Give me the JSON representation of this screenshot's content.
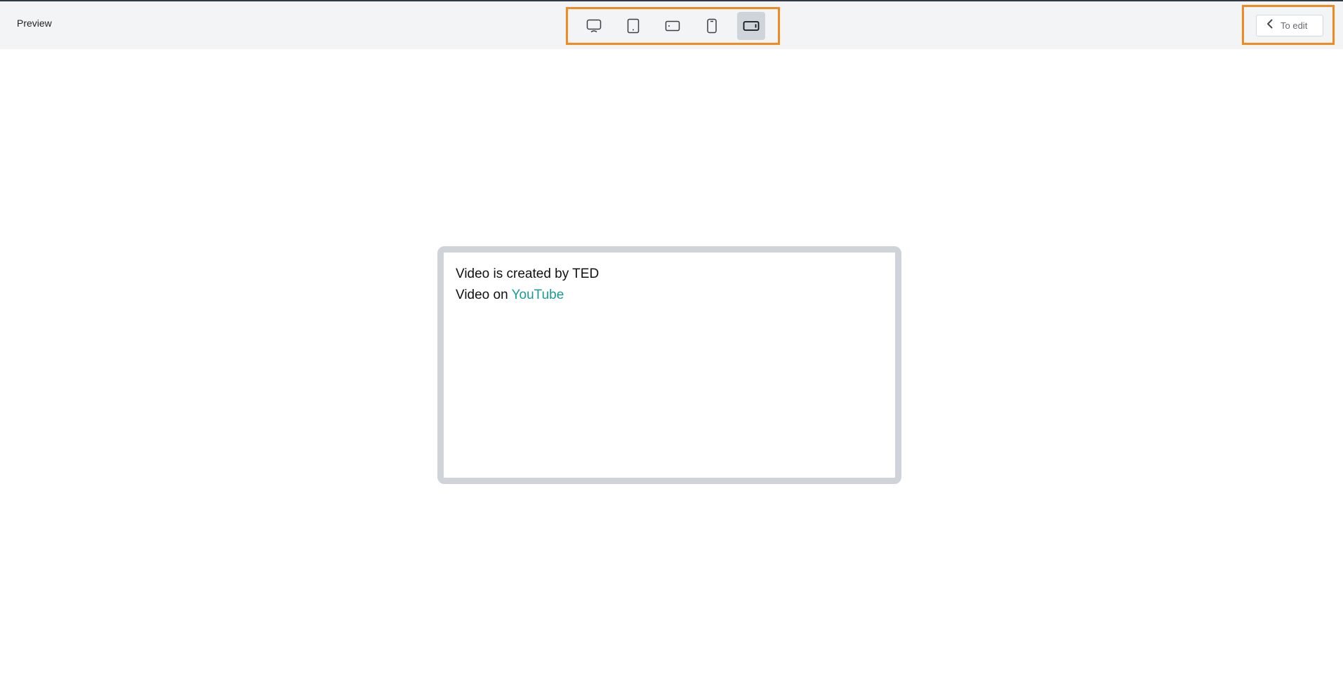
{
  "header": {
    "title": "Preview",
    "devices": [
      {
        "name": "desktop-icon",
        "active": false
      },
      {
        "name": "tablet-portrait-icon",
        "active": false
      },
      {
        "name": "tablet-landscape-icon",
        "active": false
      },
      {
        "name": "phone-portrait-icon",
        "active": false
      },
      {
        "name": "phone-landscape-icon",
        "active": true
      }
    ],
    "edit_button": {
      "label": "To edit",
      "icon": "chevron-left-icon"
    }
  },
  "preview": {
    "line1": "Video is created by TED",
    "line2_prefix": "Video on ",
    "line2_link": "YouTube"
  },
  "colors": {
    "highlight_border": "#f28a22",
    "link": "#1a9a96",
    "active_device_bg": "#cfd4da",
    "frame_border": "#d0d4da"
  }
}
